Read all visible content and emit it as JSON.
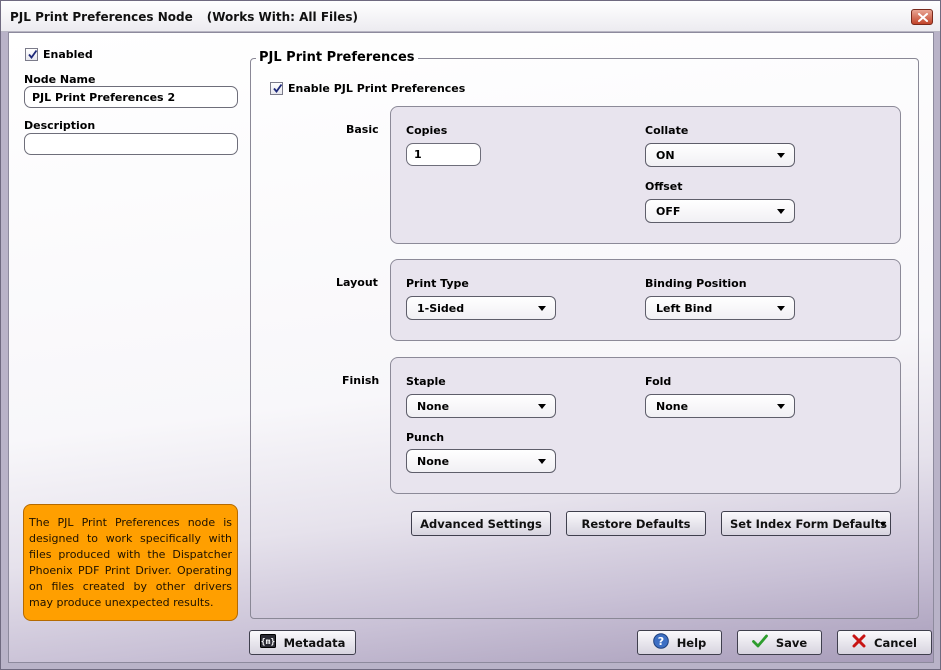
{
  "window": {
    "title": "PJL Print Preferences Node",
    "works_with": "(Works With: All Files)"
  },
  "left": {
    "enabled_label": "Enabled",
    "enabled_checked": true,
    "node_name_label": "Node Name",
    "node_name_value": "PJL Print Preferences 2",
    "description_label": "Description",
    "description_value": "",
    "note": "The PJL Print Preferences node is designed to work specifically with files produced with the Dispatcher Phoenix PDF Print Driver. Operating on files created by other drivers may produce unexpected results."
  },
  "main": {
    "group_title": "PJL Print Preferences",
    "enable_label": "Enable PJL Print Preferences",
    "enable_checked": true,
    "basic": {
      "label": "Basic",
      "copies_label": "Copies",
      "copies_value": "1",
      "collate_label": "Collate",
      "collate_value": "ON",
      "offset_label": "Offset",
      "offset_value": "OFF"
    },
    "layout": {
      "label": "Layout",
      "print_type_label": "Print Type",
      "print_type_value": "1-Sided",
      "binding_label": "Binding Position",
      "binding_value": "Left Bind"
    },
    "finish": {
      "label": "Finish",
      "staple_label": "Staple",
      "staple_value": "None",
      "fold_label": "Fold",
      "fold_value": "None",
      "punch_label": "Punch",
      "punch_value": "None"
    },
    "buttons": {
      "advanced": "Advanced Settings",
      "restore": "Restore Defaults",
      "index_form": "Set Index Form Defaults"
    }
  },
  "footer": {
    "metadata": "Metadata",
    "help": "Help",
    "save": "Save",
    "cancel": "Cancel"
  },
  "icons": {
    "close": "close-icon",
    "metadata": "metadata-icon",
    "help": "help-icon",
    "save": "checkmark-icon",
    "cancel": "cross-icon"
  },
  "colors": {
    "note_background": "#ff9f00",
    "save_check": "#2e9d2e",
    "cancel_cross": "#c81414",
    "close_button": "#c2432a"
  }
}
